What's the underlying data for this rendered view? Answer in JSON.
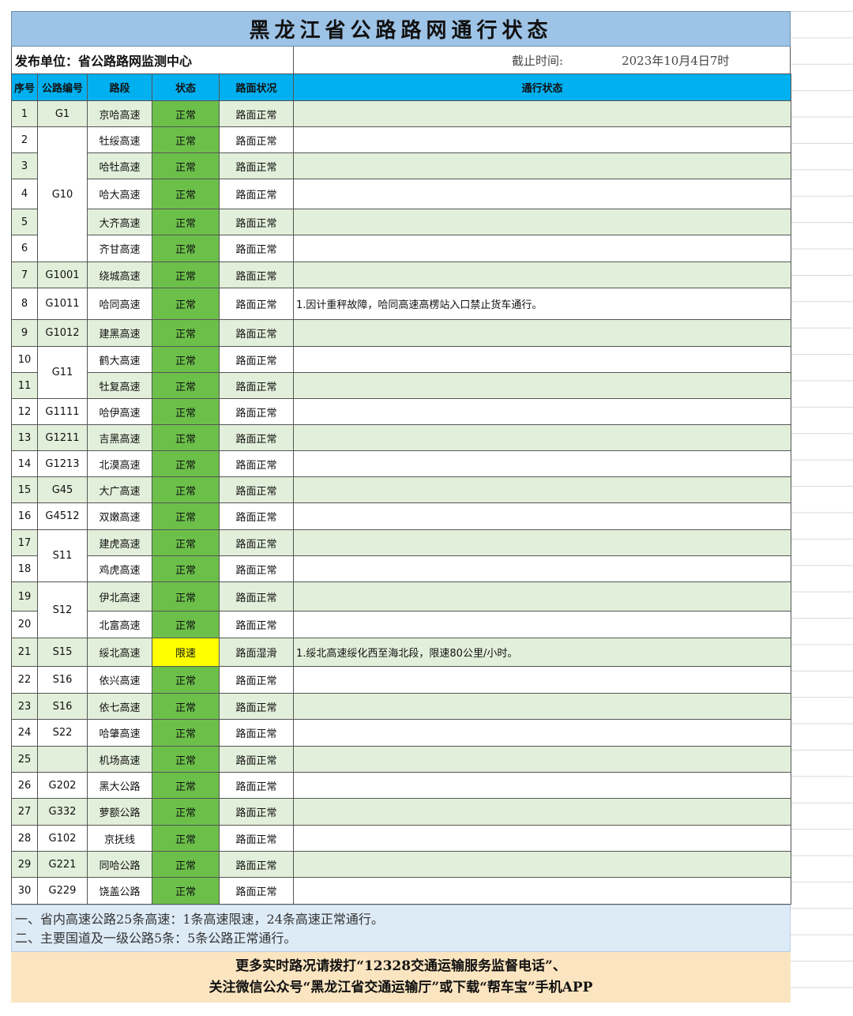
{
  "title": "黑龙江省公路路网通行状态",
  "publisher": "发布单位：省公路路网监测中心",
  "cutoff_label": "截止时间:",
  "cutoff_value": "2023年10月4日7时",
  "headers": [
    "序号",
    "公路编号",
    "路段",
    "状态",
    "路面状况",
    "通行状态"
  ],
  "rows": [
    {
      "no": "1",
      "code": "G1",
      "seg": "京哈高速",
      "status": "正常",
      "road": "路面正常",
      "note": ""
    },
    {
      "no": "2",
      "code": "G10",
      "seg": "牡绥高速",
      "status": "正常",
      "road": "路面正常",
      "note": ""
    },
    {
      "no": "3",
      "code": "",
      "seg": "哈牡高速",
      "status": "正常",
      "road": "路面正常",
      "note": ""
    },
    {
      "no": "4",
      "code": "",
      "seg": "哈大高速",
      "status": "正常",
      "road": "路面正常",
      "note": ""
    },
    {
      "no": "5",
      "code": "",
      "seg": "大齐高速",
      "status": "正常",
      "road": "路面正常",
      "note": ""
    },
    {
      "no": "6",
      "code": "",
      "seg": "齐甘高速",
      "status": "正常",
      "road": "路面正常",
      "note": ""
    },
    {
      "no": "7",
      "code": "G1001",
      "seg": "绕城高速",
      "status": "正常",
      "road": "路面正常",
      "note": ""
    },
    {
      "no": "8",
      "code": "G1011",
      "seg": "哈同高速",
      "status": "正常",
      "road": "路面正常",
      "note": "1.因计重秤故障，哈同高速高楞站入口禁止货车通行。"
    },
    {
      "no": "9",
      "code": "G1012",
      "seg": "建黑高速",
      "status": "正常",
      "road": "路面正常",
      "note": ""
    },
    {
      "no": "10",
      "code": "G11",
      "seg": "鹤大高速",
      "status": "正常",
      "road": "路面正常",
      "note": ""
    },
    {
      "no": "11",
      "code": "",
      "seg": "牡复高速",
      "status": "正常",
      "road": "路面正常",
      "note": ""
    },
    {
      "no": "12",
      "code": "G1111",
      "seg": "哈伊高速",
      "status": "正常",
      "road": "路面正常",
      "note": ""
    },
    {
      "no": "13",
      "code": "G1211",
      "seg": "吉黑高速",
      "status": "正常",
      "road": "路面正常",
      "note": ""
    },
    {
      "no": "14",
      "code": "G1213",
      "seg": "北漠高速",
      "status": "正常",
      "road": "路面正常",
      "note": ""
    },
    {
      "no": "15",
      "code": "G45",
      "seg": "大广高速",
      "status": "正常",
      "road": "路面正常",
      "note": ""
    },
    {
      "no": "16",
      "code": "G4512",
      "seg": "双嫩高速",
      "status": "正常",
      "road": "路面正常",
      "note": ""
    },
    {
      "no": "17",
      "code": "S11",
      "seg": "建虎高速",
      "status": "正常",
      "road": "路面正常",
      "note": ""
    },
    {
      "no": "18",
      "code": "",
      "seg": "鸡虎高速",
      "status": "正常",
      "road": "路面正常",
      "note": ""
    },
    {
      "no": "19",
      "code": "S12",
      "seg": "伊北高速",
      "status": "正常",
      "road": "路面正常",
      "note": ""
    },
    {
      "no": "20",
      "code": "",
      "seg": "北富高速",
      "status": "正常",
      "road": "路面正常",
      "note": ""
    },
    {
      "no": "21",
      "code": "S15",
      "seg": "绥北高速",
      "status": "限速",
      "road": "路面湿滑",
      "note": "1.绥北高速绥化西至海北段，限速80公里/小时。"
    },
    {
      "no": "22",
      "code": "S16",
      "seg": "依兴高速",
      "status": "正常",
      "road": "路面正常",
      "note": ""
    },
    {
      "no": "23",
      "code": "S16",
      "seg": "依七高速",
      "status": "正常",
      "road": "路面正常",
      "note": ""
    },
    {
      "no": "24",
      "code": "S22",
      "seg": "哈肇高速",
      "status": "正常",
      "road": "路面正常",
      "note": ""
    },
    {
      "no": "25",
      "code": "",
      "seg": "机场高速",
      "status": "正常",
      "road": "路面正常",
      "note": ""
    },
    {
      "no": "26",
      "code": "G202",
      "seg": "黑大公路",
      "status": "正常",
      "road": "路面正常",
      "note": ""
    },
    {
      "no": "27",
      "code": "G332",
      "seg": "萝额公路",
      "status": "正常",
      "road": "路面正常",
      "note": ""
    },
    {
      "no": "28",
      "code": "G102",
      "seg": "京抚线",
      "status": "正常",
      "road": "路面正常",
      "note": ""
    },
    {
      "no": "29",
      "code": "G221",
      "seg": "同哈公路",
      "status": "正常",
      "road": "路面正常",
      "note": ""
    },
    {
      "no": "30",
      "code": "G229",
      "seg": "饶盖公路",
      "status": "正常",
      "road": "路面正常",
      "note": ""
    }
  ],
  "summary": [
    "一、省内高速公路25条高速：1条高速限速，24条高速正常通行。",
    "二、主要国道及一级公路5条：5条公路正常通行。"
  ],
  "footer": [
    "更多实时路况请拨打“12328交通运输服务监督电话”、",
    "关注微信公众号“黑龙江省交通运输厅”或下载“帮车宝”手机APP"
  ],
  "colors": {
    "header": "#00b0f0",
    "title": "#9dc3e6",
    "normal": "#6cc04a",
    "limit": "#ffff00",
    "rowAlt": "#e2efda"
  }
}
